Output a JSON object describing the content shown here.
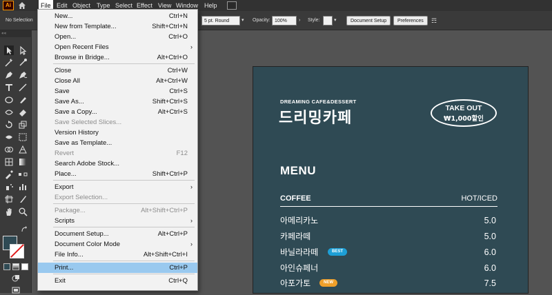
{
  "app": {
    "logo": "Ai"
  },
  "menubar": {
    "items": [
      "File",
      "Edit",
      "Object",
      "Type",
      "Select",
      "Effect",
      "View",
      "Window",
      "Help"
    ],
    "active": "File"
  },
  "control_bar": {
    "selection": "No Selection",
    "stroke_profile": "5 pt. Round",
    "opacity_label": "Opacity:",
    "opacity_value": "100%",
    "style_label": "Style:",
    "document_setup": "Document Setup",
    "preferences": "Preferences"
  },
  "toolbar": {
    "handle": "««"
  },
  "file_menu": {
    "groups": [
      [
        {
          "label": "New...",
          "shortcut": "Ctrl+N"
        },
        {
          "label": "New from Template...",
          "shortcut": "Shift+Ctrl+N"
        },
        {
          "label": "Open...",
          "shortcut": "Ctrl+O"
        },
        {
          "label": "Open Recent Files",
          "shortcut": "",
          "submenu": true
        },
        {
          "label": "Browse in Bridge...",
          "shortcut": "Alt+Ctrl+O"
        }
      ],
      [
        {
          "label": "Close",
          "shortcut": "Ctrl+W"
        },
        {
          "label": "Close All",
          "shortcut": "Alt+Ctrl+W"
        },
        {
          "label": "Save",
          "shortcut": "Ctrl+S"
        },
        {
          "label": "Save As...",
          "shortcut": "Shift+Ctrl+S"
        },
        {
          "label": "Save a Copy...",
          "shortcut": "Alt+Ctrl+S"
        },
        {
          "label": "Save Selected Slices...",
          "shortcut": "",
          "disabled": true
        },
        {
          "label": "Version History",
          "shortcut": ""
        },
        {
          "label": "Save as Template...",
          "shortcut": ""
        },
        {
          "label": "Revert",
          "shortcut": "F12",
          "disabled": true
        },
        {
          "label": "Search Adobe Stock...",
          "shortcut": ""
        },
        {
          "label": "Place...",
          "shortcut": "Shift+Ctrl+P"
        }
      ],
      [
        {
          "label": "Export",
          "shortcut": "",
          "submenu": true
        },
        {
          "label": "Export Selection...",
          "shortcut": "",
          "disabled": true
        }
      ],
      [
        {
          "label": "Package...",
          "shortcut": "Alt+Shift+Ctrl+P",
          "disabled": true
        },
        {
          "label": "Scripts",
          "shortcut": "",
          "submenu": true
        }
      ],
      [
        {
          "label": "Document Setup...",
          "shortcut": "Alt+Ctrl+P"
        },
        {
          "label": "Document Color Mode",
          "shortcut": "",
          "submenu": true
        },
        {
          "label": "File Info...",
          "shortcut": "Alt+Shift+Ctrl+I"
        }
      ],
      [
        {
          "label": "Print...",
          "shortcut": "Ctrl+P",
          "highlighted": true
        }
      ],
      [
        {
          "label": "Exit",
          "shortcut": "Ctrl+Q"
        }
      ]
    ]
  },
  "artboard": {
    "eyebrow": "DREAMING CAFE&DESSERT",
    "brand": "드리밍카페",
    "takeout_line1": "TAKE OUT",
    "takeout_line2": "₩1,000할인",
    "menu_title": "MENU",
    "section": "COFFEE",
    "hot_iced": "HOT/ICED",
    "items": [
      {
        "name": "아메리카노",
        "price": "5.0",
        "badge": ""
      },
      {
        "name": "카페라떼",
        "price": "5.0",
        "badge": ""
      },
      {
        "name": "바닐라라떼",
        "price": "6.0",
        "badge": "BEST"
      },
      {
        "name": "아인슈페너",
        "price": "6.0",
        "badge": ""
      },
      {
        "name": "아포가토",
        "price": "7.5",
        "badge": "NEW"
      }
    ],
    "badge_colors": {
      "BEST": "#1d9fd6",
      "NEW": "#f0a02a"
    },
    "bg_color": "#2f4a54"
  }
}
